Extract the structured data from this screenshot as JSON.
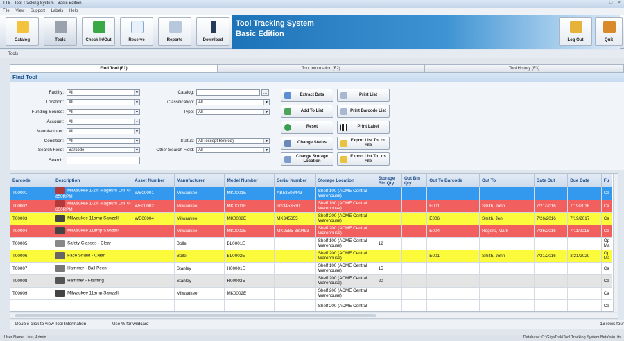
{
  "window": {
    "title": "TTS - Tool Tracking System - Basic Edition"
  },
  "menu": [
    "File",
    "View",
    "Support",
    "Labels",
    "Help"
  ],
  "toolbar": {
    "catalog": "Catalog",
    "tools": "Tools",
    "check": "Check In/Out",
    "reserve": "Reserve",
    "reports": "Reports",
    "download": "Download",
    "logout": "Log Out",
    "quit": "Quit"
  },
  "brand": {
    "line1": "Tool Tracking System",
    "line2": "Basic Edition"
  },
  "tools_label": "Tools",
  "tabs": [
    "Find Tool (F1)",
    "Tool Information (F2)",
    "Tool History (F3)"
  ],
  "find_header": "Find Tool",
  "form": {
    "facility_label": "Facility:",
    "facility": "All",
    "location_label": "Location:",
    "location": "All",
    "funding_label": "Funding Source:",
    "funding": "All",
    "account_label": "Account:",
    "account": "All",
    "manufacturer_label": "Manufacturer:",
    "manufacturer": "All",
    "condition_label": "Condition:",
    "condition": "All",
    "search_field_label": "Search Field:",
    "search_field": "Barcode",
    "search_label": "Search:",
    "search": "",
    "catalog_label": "Catalog:",
    "catalog": "",
    "catalog_btn": "...",
    "classification_label": "Classification:",
    "classification": "All",
    "type_label": "Type:",
    "type": "All",
    "status_label": "Status:",
    "status": "All  (except Retired)",
    "other_search_label": "Other Search Field:",
    "other_search": "All"
  },
  "actions": {
    "extract": "Extract Data",
    "add": "Add To List",
    "reset": "Reset",
    "change_status": "Change Status",
    "change_storage": "Change Storage Location",
    "print_list": "Print List",
    "print_barcode": "Print Barcode List",
    "print_label": "Print Label",
    "export_txt": "Export List To .txt File",
    "export_xls": "Export List To .xls File"
  },
  "grid": {
    "columns": [
      "Barcode",
      "Description",
      "Asset Number",
      "Manufacturer",
      "Model Number",
      "Serial Number",
      "Storage Location",
      "Storage Bin Qty",
      "Out Bin Qty",
      "Out To Barcode",
      "Out To",
      "Date Out",
      "Due Date",
      "Fu"
    ],
    "rows": [
      {
        "style": "blue",
        "cells": [
          "T00001",
          "Milwaukee 1-2in Magnum Drill 0-850RPM",
          "WE00001",
          "Milwaukee",
          "MK0001E",
          "AB53503443",
          "Shelf 100 (ACME Central Warehouse)",
          "",
          "",
          "",
          "",
          "",
          "",
          "Ca"
        ]
      },
      {
        "style": "red",
        "cells": [
          "T00002",
          "Milwaukee 1-2in Magnum Drill 0-850RPM",
          "WE00002",
          "Milwaukee",
          "MK0001E",
          "TG3453530",
          "Shelf 100 (ACME Central Warehouse)",
          "",
          "",
          "E001",
          "Smith, John",
          "7/21/2016",
          "7/19/2016",
          "Ca"
        ]
      },
      {
        "style": "yellow",
        "cells": [
          "T00003",
          "Milwaukee 11amp Sawzall",
          "WE00004",
          "Milwaukee",
          "MK0002E",
          "MK345355",
          "Shelf 200 (ACME Central Warehouse)",
          "",
          "",
          "E006",
          "Smith, Jen",
          "7/26/2016",
          "7/19/2017",
          "Ca"
        ]
      },
      {
        "style": "red",
        "cells": [
          "T00004",
          "Milwaukee 11amp Sawzall",
          "",
          "Milwaukee",
          "MK0002E",
          "MK2585-389453",
          "Shelf 200 (ACME Central Warehouse)",
          "",
          "",
          "E004",
          "Rogers, Mark",
          "7/26/2016",
          "7/11/2016",
          "Ca"
        ]
      },
      {
        "style": "white",
        "cells": [
          "T00005",
          "Safety Glasses - Clear",
          "",
          "Bolle",
          "BL0001E",
          "",
          "Shelf 100 (ACME Central Warehouse)",
          "12",
          "",
          "",
          "",
          "",
          "",
          "Op Ma"
        ]
      },
      {
        "style": "yellow",
        "cells": [
          "T00006",
          "Face Shield - Clear",
          "",
          "Bolle",
          "BL0002E",
          "",
          "Shelf 200 (ACME Central Warehouse)",
          "",
          "",
          "E001",
          "Smith, John",
          "7/21/2016",
          "3/21/2020",
          "Op Ma"
        ]
      },
      {
        "style": "white",
        "cells": [
          "T00007",
          "Hammer - Ball Peen",
          "",
          "Stanley",
          "H00001E",
          "",
          "Shelf 100 (ACME Central Warehouse)",
          "15",
          "",
          "",
          "",
          "",
          "",
          "Ca"
        ]
      },
      {
        "style": "gray",
        "cells": [
          "T00008",
          "Hammer - Framing",
          "",
          "Stanley",
          "H00002E",
          "",
          "Shelf 200 (ACME Central Warehouse)",
          "20",
          "",
          "",
          "",
          "",
          "",
          "Ca"
        ]
      },
      {
        "style": "white",
        "cells": [
          "T00009",
          "Milwaukee 11amp Sawzall",
          "",
          "Milwaukee",
          "MK0002E",
          "",
          "Shelf 200 (ACME Central Warehouse)",
          "",
          "",
          "",
          "",
          "",
          "",
          "Ca"
        ]
      },
      {
        "style": "white",
        "cells": [
          "",
          "",
          "",
          "",
          "",
          "",
          "Shelf 200 (ACME Central",
          "",
          "",
          "",
          "",
          "",
          "",
          "Ca"
        ]
      }
    ]
  },
  "status": {
    "hint": "Double-click to view Tool Information",
    "wildcard": "Use % for wildcard",
    "count": "16 rows four"
  },
  "footer": {
    "user": "User Name:  User, Admin",
    "db": "Database:  C:\\GigaTrak\\Tool Tracking System Beta\\win. tts"
  },
  "colors": {
    "row_selected": "#3399ef",
    "row_overdue": "#f25f5f",
    "row_checked_out": "#fbfb3c",
    "brand": "#1d73b8"
  }
}
